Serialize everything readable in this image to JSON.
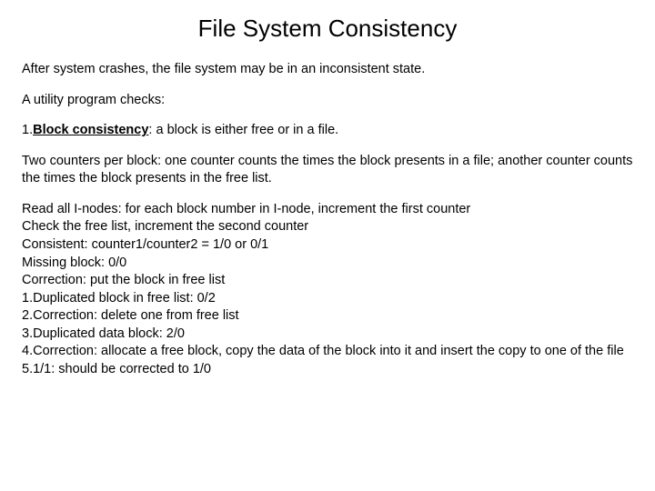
{
  "title": "File System Consistency",
  "p1": "After system crashes, the file system may be in an inconsistent state.",
  "p2": "A utility program checks:",
  "p3_prefix": "1.",
  "p3_bold": "Block consistency",
  "p3_rest": ": a block is either free or in a file.",
  "p4": "Two counters per block: one counter counts the times the block presents in a file; another counter counts the times the block presents in the free list.",
  "lines": [
    "Read all I-nodes: for each block number in I-node, increment the first counter",
    "Check the free list, increment the second counter",
    "Consistent: counter1/counter2 = 1/0 or 0/1",
    "Missing block: 0/0",
    "Correction: put the block in free list",
    "1.Duplicated block in free list: 0/2",
    "2.Correction: delete one from free list",
    "3.Duplicated data block: 2/0",
    "4.Correction: allocate a free block, copy the data of the block into it and insert the copy to one of the file",
    "5.1/1: should be corrected to 1/0"
  ]
}
